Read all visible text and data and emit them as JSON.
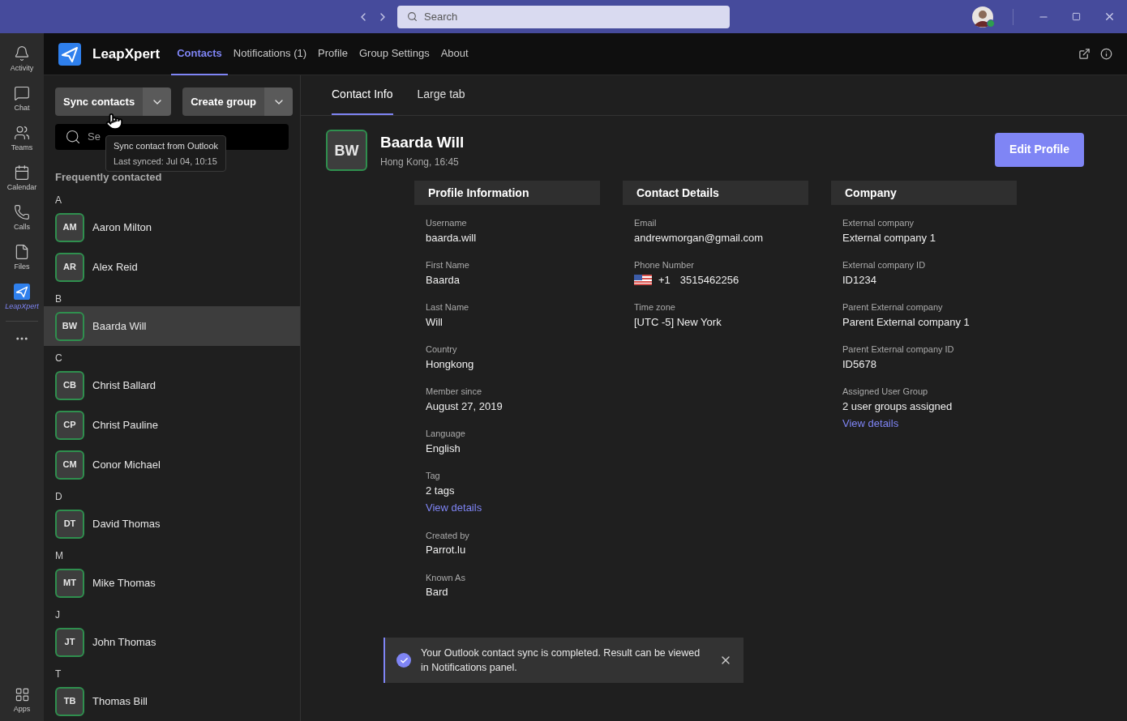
{
  "title_bar": {
    "search_placeholder": "Search"
  },
  "rail": [
    {
      "label": "Activity",
      "selected": false
    },
    {
      "label": "Chat",
      "selected": false
    },
    {
      "label": "Teams",
      "selected": false
    },
    {
      "label": "Calendar",
      "selected": false
    },
    {
      "label": "Calls",
      "selected": false
    },
    {
      "label": "Files",
      "selected": false
    },
    {
      "label": "LeapXpert",
      "selected": true
    }
  ],
  "rail_bottom": {
    "label": "Apps"
  },
  "app_header": {
    "name": "LeapXpert",
    "nav": [
      {
        "label": "Contacts",
        "selected": true
      },
      {
        "label": "Notifications (1)",
        "selected": false
      },
      {
        "label": "Profile",
        "selected": false
      },
      {
        "label": "Group Settings",
        "selected": false
      },
      {
        "label": "About",
        "selected": false
      }
    ]
  },
  "sidebar": {
    "buttons": [
      "Sync contacts",
      "Create group"
    ],
    "search_placeholder": "Se",
    "tooltip": {
      "title": "Sync contact from Outlook",
      "subtitle": "Last synced: Jul 04, 10:15"
    },
    "heading": "Frequently contacted",
    "groups": [
      {
        "letter": "A",
        "contacts": [
          {
            "initials": "AM",
            "name": "Aaron Milton",
            "selected": false
          },
          {
            "initials": "AR",
            "name": "Alex Reid",
            "selected": false
          }
        ]
      },
      {
        "letter": "B",
        "contacts": [
          {
            "initials": "BW",
            "name": "Baarda Will",
            "selected": true
          }
        ]
      },
      {
        "letter": "C",
        "contacts": [
          {
            "initials": "CB",
            "name": "Christ Ballard",
            "selected": false
          },
          {
            "initials": "CP",
            "name": "Christ Pauline",
            "selected": false
          },
          {
            "initials": "CM",
            "name": "Conor Michael",
            "selected": false
          }
        ]
      },
      {
        "letter": "D",
        "contacts": [
          {
            "initials": "DT",
            "name": "David Thomas",
            "selected": false
          }
        ]
      },
      {
        "letter": "M",
        "contacts": [
          {
            "initials": "MT",
            "name": "Mike Thomas",
            "selected": false
          }
        ]
      },
      {
        "letter": "J",
        "contacts": [
          {
            "initials": "JT",
            "name": "John Thomas",
            "selected": false
          }
        ]
      },
      {
        "letter": "T",
        "contacts": [
          {
            "initials": "TB",
            "name": "Thomas Bill",
            "selected": false
          }
        ]
      }
    ]
  },
  "tabs": [
    {
      "label": "Contact Info",
      "selected": true
    },
    {
      "label": "Large tab",
      "selected": false
    }
  ],
  "contact": {
    "initials": "BW",
    "name": "Baarda Will",
    "subtitle": "Hong Kong, 16:45",
    "edit_button": "Edit Profile"
  },
  "sections": [
    {
      "title": "Profile Information",
      "fields": [
        {
          "kind": "text",
          "label": "Username",
          "value": "baarda.will"
        },
        {
          "kind": "text",
          "label": "First Name",
          "value": "Baarda"
        },
        {
          "kind": "text",
          "label": "Last Name",
          "value": "Will"
        },
        {
          "kind": "text",
          "label": "Country",
          "value": "Hongkong"
        },
        {
          "kind": "text",
          "label": "Member since",
          "value": "August 27, 2019"
        },
        {
          "kind": "text",
          "label": "Language",
          "value": "English"
        },
        {
          "kind": "link",
          "label": "Tag",
          "value": "2 tags",
          "link": "View details"
        },
        {
          "kind": "text",
          "label": "Created by",
          "value": "Parrot.lu"
        },
        {
          "kind": "text",
          "label": "Known As",
          "value": "Bard"
        }
      ]
    },
    {
      "title": "Contact Details",
      "fields": [
        {
          "kind": "text",
          "label": "Email",
          "value": "andrewmorgan@gmail.com"
        },
        {
          "kind": "phone",
          "label": "Phone Number",
          "code": "+1",
          "value": "3515462256"
        },
        {
          "kind": "text",
          "label": "Time zone",
          "value": "[UTC -5] New York"
        }
      ]
    },
    {
      "title": "Company",
      "fields": [
        {
          "kind": "text",
          "label": "External company",
          "value": "External company 1"
        },
        {
          "kind": "text",
          "label": "External company ID",
          "value": "ID1234"
        },
        {
          "kind": "text",
          "label": "Parent External company",
          "value": "Parent External company 1"
        },
        {
          "kind": "text",
          "label": "Parent External company ID",
          "value": "ID5678"
        },
        {
          "kind": "link",
          "label": "Assigned User Group",
          "value": "2 user groups assigned",
          "link": "View details"
        }
      ]
    }
  ],
  "toast": {
    "message": "Your Outlook contact sync is completed. Result can be viewed in Notifications panel."
  }
}
